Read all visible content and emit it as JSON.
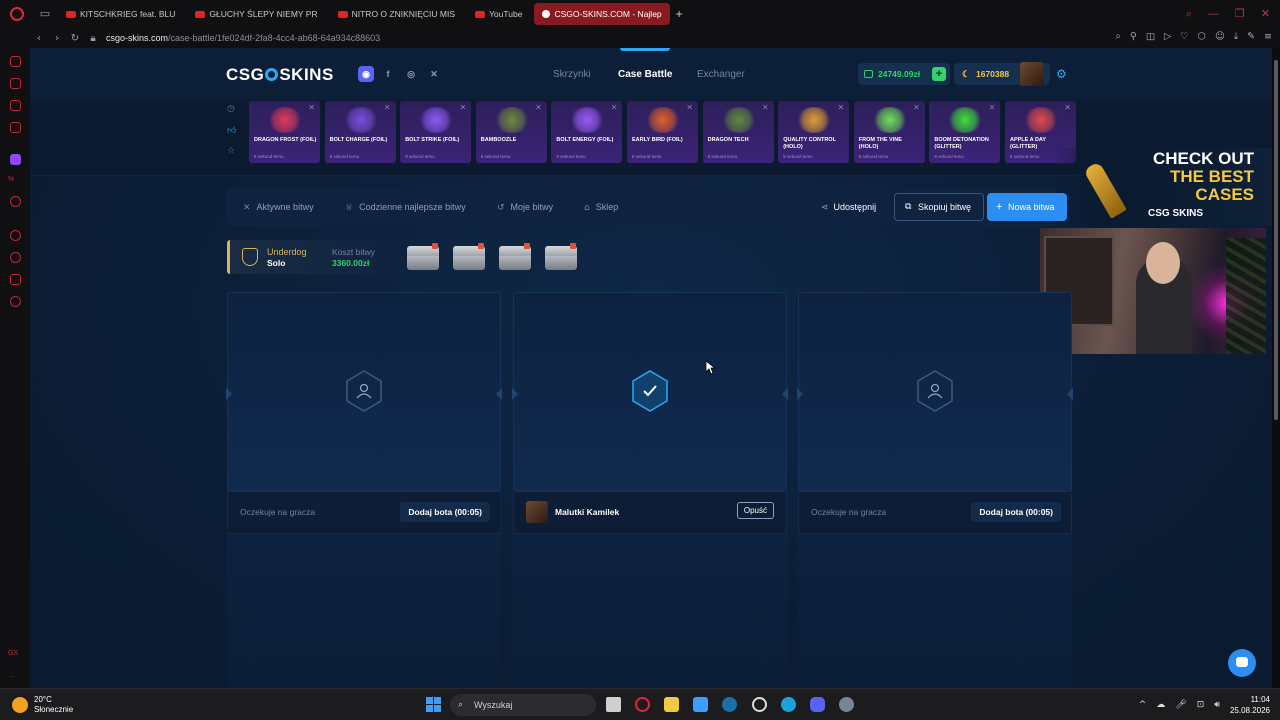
{
  "browser": {
    "tabs": [
      {
        "label": "KITSCHKRIEG feat. BLU",
        "active": false
      },
      {
        "label": "GŁUCHY ŚLEPY NIEMY PR",
        "active": false
      },
      {
        "label": "NITRO O ZNIKNIĘCIU MIS",
        "active": false
      },
      {
        "label": "YouTube",
        "active": false
      },
      {
        "label": "CSGO-SKINS.COM - Najlep",
        "active": true
      }
    ],
    "url_host": "csgo-skins.com",
    "url_path": "/case-battle/1fe024df-2fa8-4cc4-ab68-64a934c88603"
  },
  "site": {
    "logo": "CSG  SKINS",
    "logo_left": "CSG",
    "logo_right": "SKINS",
    "nav": [
      "Skrzynki",
      "Case Battle",
      "Exchanger"
    ],
    "active_nav": "Case Battle",
    "balance": "24749.09zł",
    "coins": "1670388",
    "accent_color": "#2da8f5",
    "money_color": "#2fd46a"
  },
  "drops": [
    {
      "name": "DRAGON FROST (FOIL)",
      "time": "8 sekund temu",
      "color": "#e23a5a"
    },
    {
      "name": "BOLT CHARGE (FOIL)",
      "time": "8 sekund temu",
      "color": "#7a4fd8"
    },
    {
      "name": "BOLT STRIKE (FOIL)",
      "time": "8 sekund temu",
      "color": "#8b5cf0"
    },
    {
      "name": "BAMBOOZLE",
      "time": "8 sekund temu",
      "color": "#6d8a3a"
    },
    {
      "name": "BOLT ENERGY (FOIL)",
      "time": "8 sekund temu",
      "color": "#9a5cf5"
    },
    {
      "name": "EARLY BIRD (FOIL)",
      "time": "8 sekund temu",
      "color": "#e0602a"
    },
    {
      "name": "DRAGON TECH",
      "time": "8 sekund temu",
      "color": "#5f8a3e"
    },
    {
      "name": "QUALITY CONTROL (HOLO)",
      "time": "8 sekund temu",
      "color": "#e0a030"
    },
    {
      "name": "FROM THE VINE (HOLO)",
      "time": "8 sekund temu",
      "color": "#6ee05a"
    },
    {
      "name": "BOOM DETONATION (GLITTER)",
      "time": "8 sekund temu",
      "color": "#3ee03a"
    },
    {
      "name": "APPLE A DAY (GLITTER)",
      "time": "8 sekund temu",
      "color": "#e04a4a"
    }
  ],
  "promo": {
    "line1": "CHECK OUT",
    "line2": "THE BEST",
    "line3": "CASES",
    "brand": "CSG SKINS"
  },
  "toolbar": {
    "links": [
      "Aktywne bitwy",
      "Codzienne najlepsze bitwy",
      "Moje bitwy",
      "Sklep"
    ],
    "share": "Udostępnij",
    "copy": "Skopiuj bitwę",
    "new": "Nowa bitwa"
  },
  "battle": {
    "mode": "Underdog",
    "type": "Solo",
    "cost_label": "Koszt bitwy",
    "cost": "3360.00zł",
    "cases_count": 4
  },
  "slots": [
    {
      "state": "waiting",
      "wait_text": "Oczekuje na gracza",
      "bot_button": "Dodaj bota (00:05)"
    },
    {
      "state": "ready",
      "player": "Malutki Kamilek",
      "leave_button": "Opuść"
    },
    {
      "state": "waiting",
      "wait_text": "Oczekuje na gracza",
      "bot_button": "Dodaj bota (00:05)"
    }
  ],
  "taskbar": {
    "weather_temp": "20°C",
    "weather_desc": "Słonecznie",
    "search_placeholder": "Wyszukaj",
    "time": "11:04",
    "date": "25.08.2026"
  }
}
